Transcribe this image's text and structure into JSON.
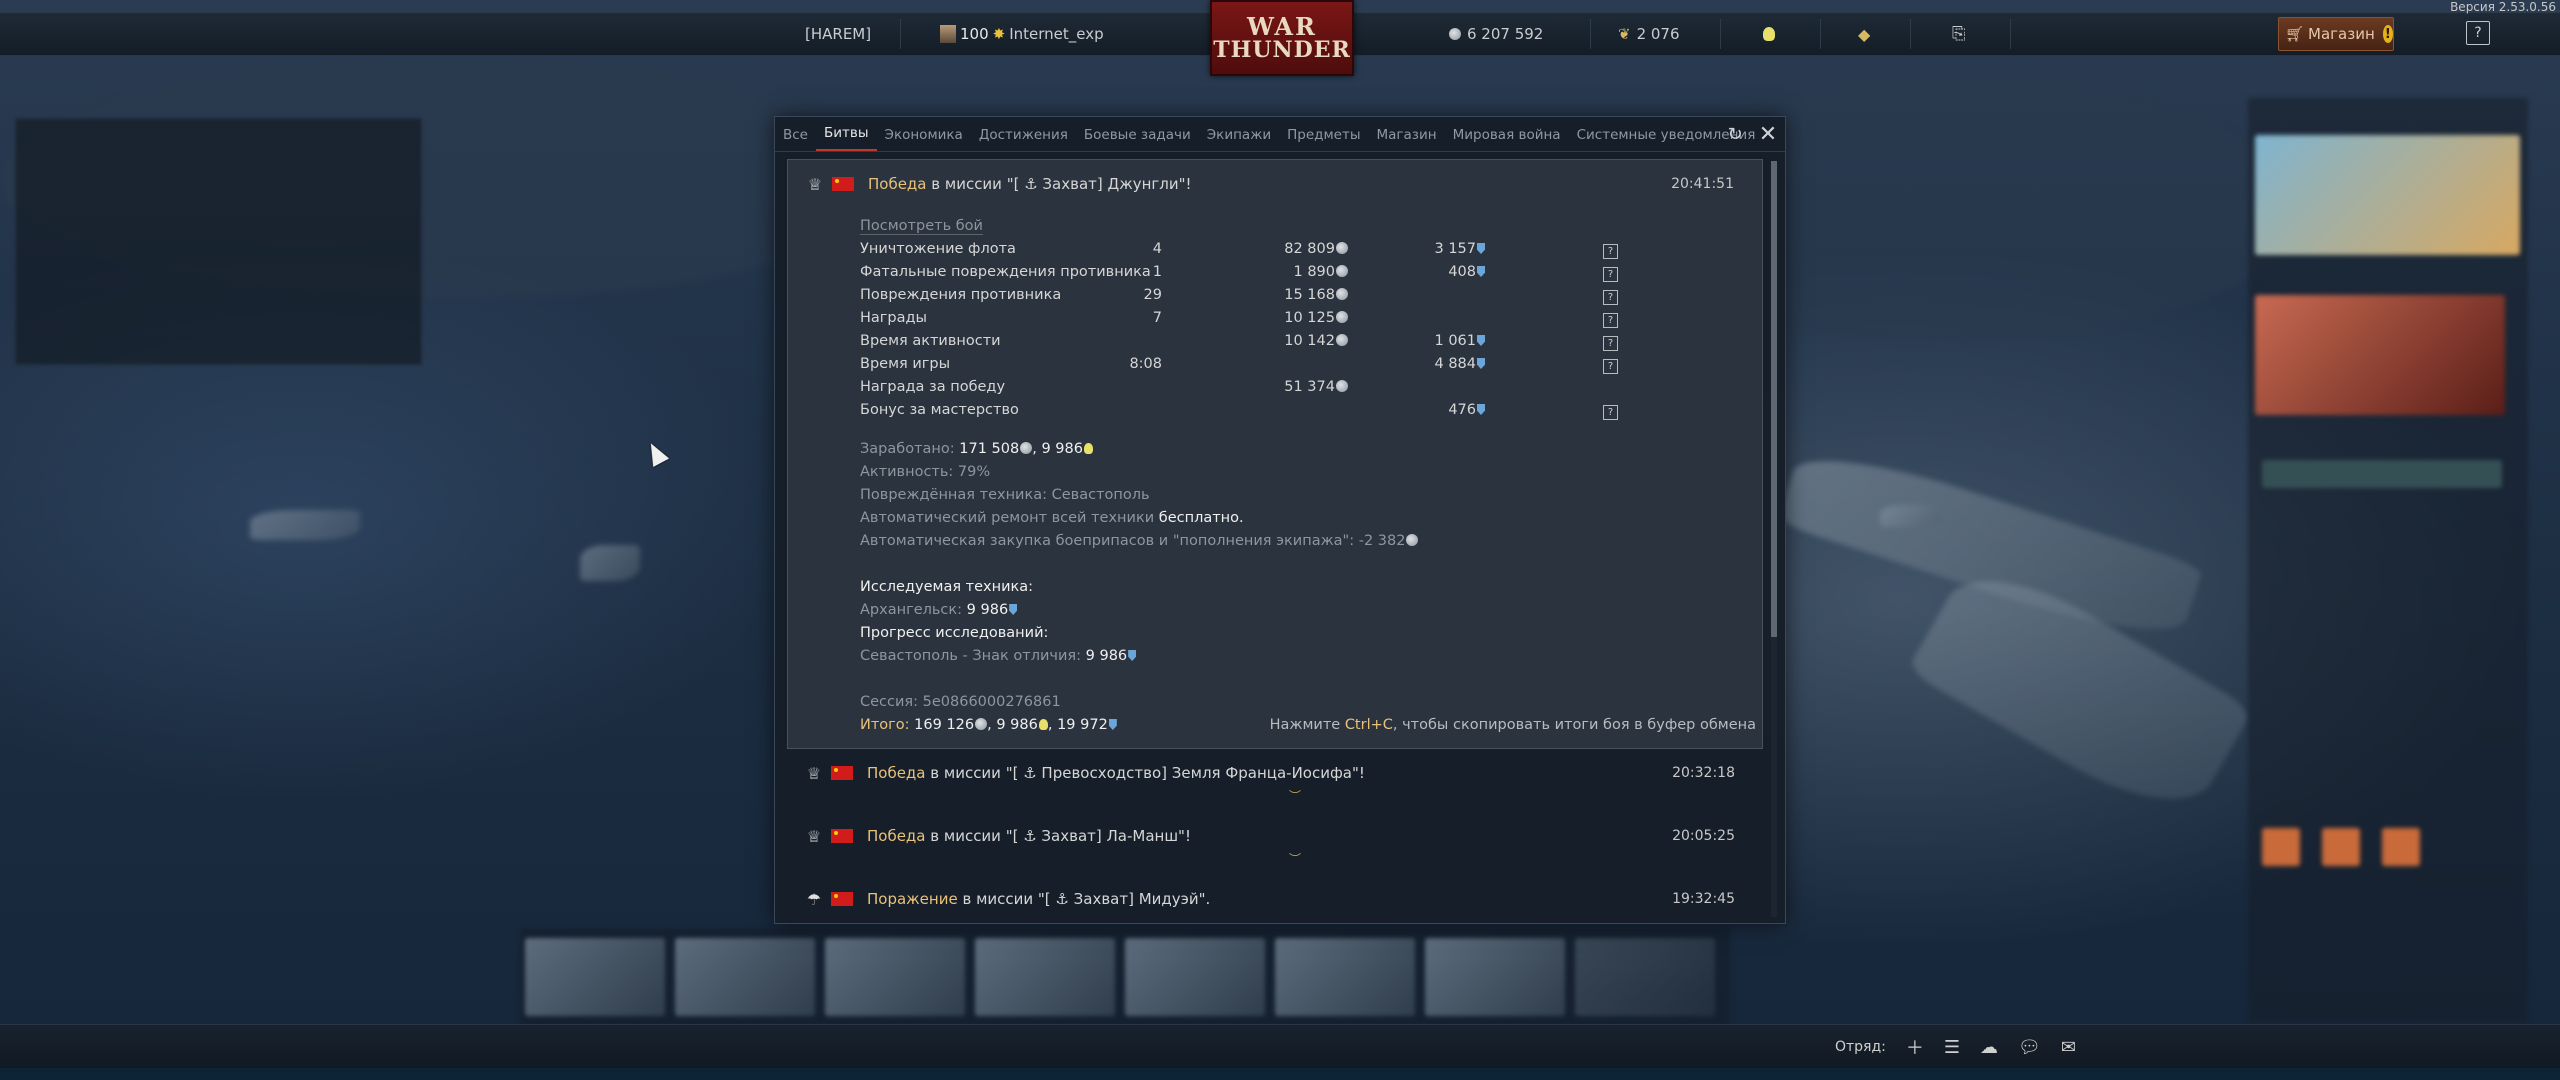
{
  "version": "Версия 2.53.0.56",
  "topbar": {
    "squadron_tag": "[HAREM]",
    "level": "100",
    "nickname": "Internet_exp",
    "logo_line1": "WAR",
    "logo_line2": "THUNDER",
    "silver_lions": "6 207 592",
    "golden_eagles": "2 076",
    "shop_label": "Магазин",
    "shop_badge": "!",
    "help": "?"
  },
  "modal": {
    "tabs": [
      "Все",
      "Битвы",
      "Экономика",
      "Достижения",
      "Боевые задачи",
      "Экипажи",
      "Предметы",
      "Магазин",
      "Мировая война",
      "Системные уведомления"
    ],
    "active_tab": "Битвы",
    "refresh_icon": "refresh-icon",
    "close_icon": "close-icon",
    "entries": [
      {
        "result": "Победа",
        "text": " в миссии \"[ ⚓ Захват] Джунгли\"!",
        "time": "20:41:51",
        "expanded": true
      },
      {
        "result": "Победа",
        "text": " в миссии \"[ ⚓ Превосходство] Земля Франца-Иосифа\"!",
        "time": "20:32:18",
        "expanded": false
      },
      {
        "result": "Победа",
        "text": " в миссии \"[ ⚓ Захват] Ла-Манш\"!",
        "time": "20:05:25",
        "expanded": false
      },
      {
        "result": "Поражение",
        "text": " в миссии \"[ ⚓ Захват] Мидуэй\".",
        "time": "19:32:45",
        "expanded": false
      }
    ],
    "battle": {
      "watch_link": "Посмотреть бой",
      "stats": [
        {
          "label": "Уничтожение флота",
          "count": "4",
          "sl": "82 809",
          "rp": "3 157",
          "help": true
        },
        {
          "label": "Фатальные повреждения противника",
          "count": "1",
          "sl": "1 890",
          "rp": "408",
          "help": true
        },
        {
          "label": "Повреждения противника",
          "count": "29",
          "sl": "15 168",
          "rp": "",
          "help": true
        },
        {
          "label": "Награды",
          "count": "7",
          "sl": "10 125",
          "rp": "",
          "help": true
        },
        {
          "label": "Время активности",
          "count": "",
          "sl": "10 142",
          "rp": "1 061",
          "help": true
        },
        {
          "label": "Время игры",
          "count": "8:08",
          "sl": "",
          "rp": "4 884",
          "help": true
        },
        {
          "label": "Награда за победу",
          "count": "",
          "sl": "51 374",
          "rp": "",
          "help": false
        },
        {
          "label": "Бонус за мастерство",
          "count": "",
          "sl": "",
          "rp": "476",
          "help": true
        }
      ],
      "earned_label": "Заработано:",
      "earned_sl": "171 508",
      "earned_rp": "9 986",
      "activity": "Активность: 79%",
      "damaged_vehicles": "Повреждённая техника: Севастополь",
      "repair_prefix": "Автоматический ремонт всей техники",
      "repair_value": "бесплатно.",
      "ammo_purchase": "Автоматическая закупка боеприпасов и \"пополнения экипажа\": -2 382",
      "research_heading": "Исследуемая техника:",
      "research_vehicle": "Архангельск:",
      "research_vehicle_rp": "9 986",
      "progress_heading": "Прогресс исследований:",
      "progress_item": "Севастополь - Знак отличия:",
      "progress_item_rp": "9 986",
      "session": "Сессия: 5e0866000276861",
      "total_label": "Итого:",
      "total_sl": "169 126",
      "total_rp1": "9 986",
      "total_rp2": "19 972",
      "copy_hint_prefix": "Нажмите ",
      "copy_hint_key": "Ctrl+C",
      "copy_hint_suffix": ", чтобы скопировать итоги боя в буфер обмена"
    }
  },
  "bottombar": {
    "squad_label": "Отряд:",
    "icons": [
      "plus-icon",
      "list-icon",
      "friends-icon",
      "chat-icon",
      "mail-icon"
    ]
  }
}
